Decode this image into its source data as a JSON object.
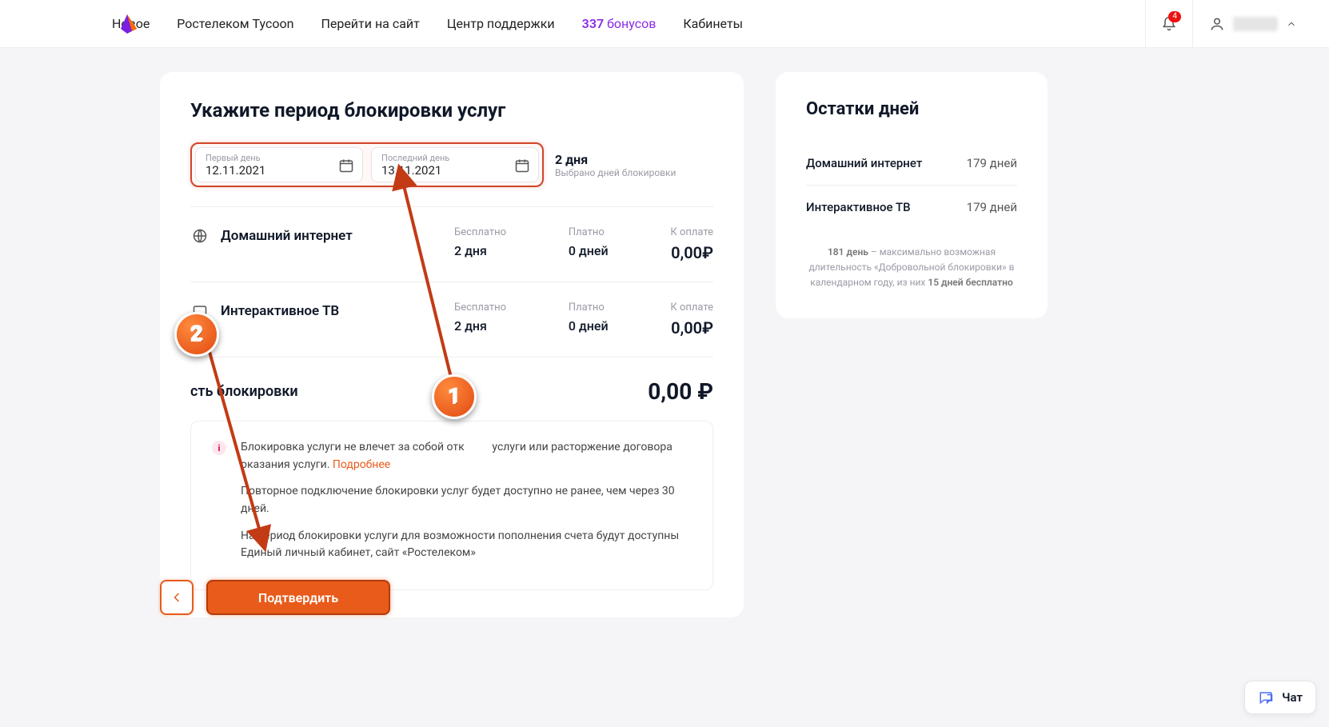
{
  "topbar": {
    "nav": {
      "new": "Новое",
      "tycoon": "Ростелеком Tycoon",
      "site": "Перейти на сайт",
      "support": "Центр поддержки",
      "bonus_num": "337",
      "bonus_txt": "бонусов",
      "cabinets": "Кабинеты"
    },
    "notif_count": "4"
  },
  "main": {
    "heading": "Укажите период блокировки услуг",
    "date_from": {
      "label": "Первый день",
      "value": "12.11.2021"
    },
    "date_to": {
      "label": "Последний день",
      "value": "13.11.2021"
    },
    "chosen": {
      "days": "2 дня",
      "caption": "Выбрано дней блокировки"
    },
    "services": [
      {
        "name": "Домашний интернет",
        "icon": "globe",
        "free_hdr": "Бесплатно",
        "free_val": "2 дня",
        "paid_hdr": "Платно",
        "paid_val": "0 дней",
        "topay_hdr": "К оплате",
        "topay_val": "0,00₽"
      },
      {
        "name": "Интерактивное ТВ",
        "icon": "tv",
        "free_hdr": "Бесплатно",
        "free_val": "2 дня",
        "paid_hdr": "Платно",
        "paid_val": "0 дней",
        "topay_hdr": "К оплате",
        "topay_val": "0,00₽"
      }
    ],
    "total": {
      "label_suffix": "сть блокировки",
      "amount": "0,00 ₽"
    },
    "info": {
      "line1_a": "Блокировка услуги не влечет за собой отк",
      "line1_b": "услуги или расторжение договора оказания услуги. ",
      "more": "Подробнее",
      "line2": "Повторное подключение блокировки услуг будет доступно не ранее, чем через 30 дней.",
      "line3": "На период блокировки услуги для возможности пополнения счета будут доступны Единый личный кабинет, сайт «Ростелеком»"
    },
    "confirm": "Подтвердить"
  },
  "side": {
    "heading": "Остатки дней",
    "rows": [
      {
        "name": "Домашний интернет",
        "days": "179 дней"
      },
      {
        "name": "Интерактивное ТВ",
        "days": "179 дней"
      }
    ],
    "note_a": "181 день",
    "note_b": " – максимально возможная длительность «Добровольной блокировки» в календарном году, из них ",
    "note_c": "15 дней бесплатно"
  },
  "chat": {
    "label": "Чат"
  },
  "annotations": {
    "m1": "1",
    "m2": "2"
  }
}
